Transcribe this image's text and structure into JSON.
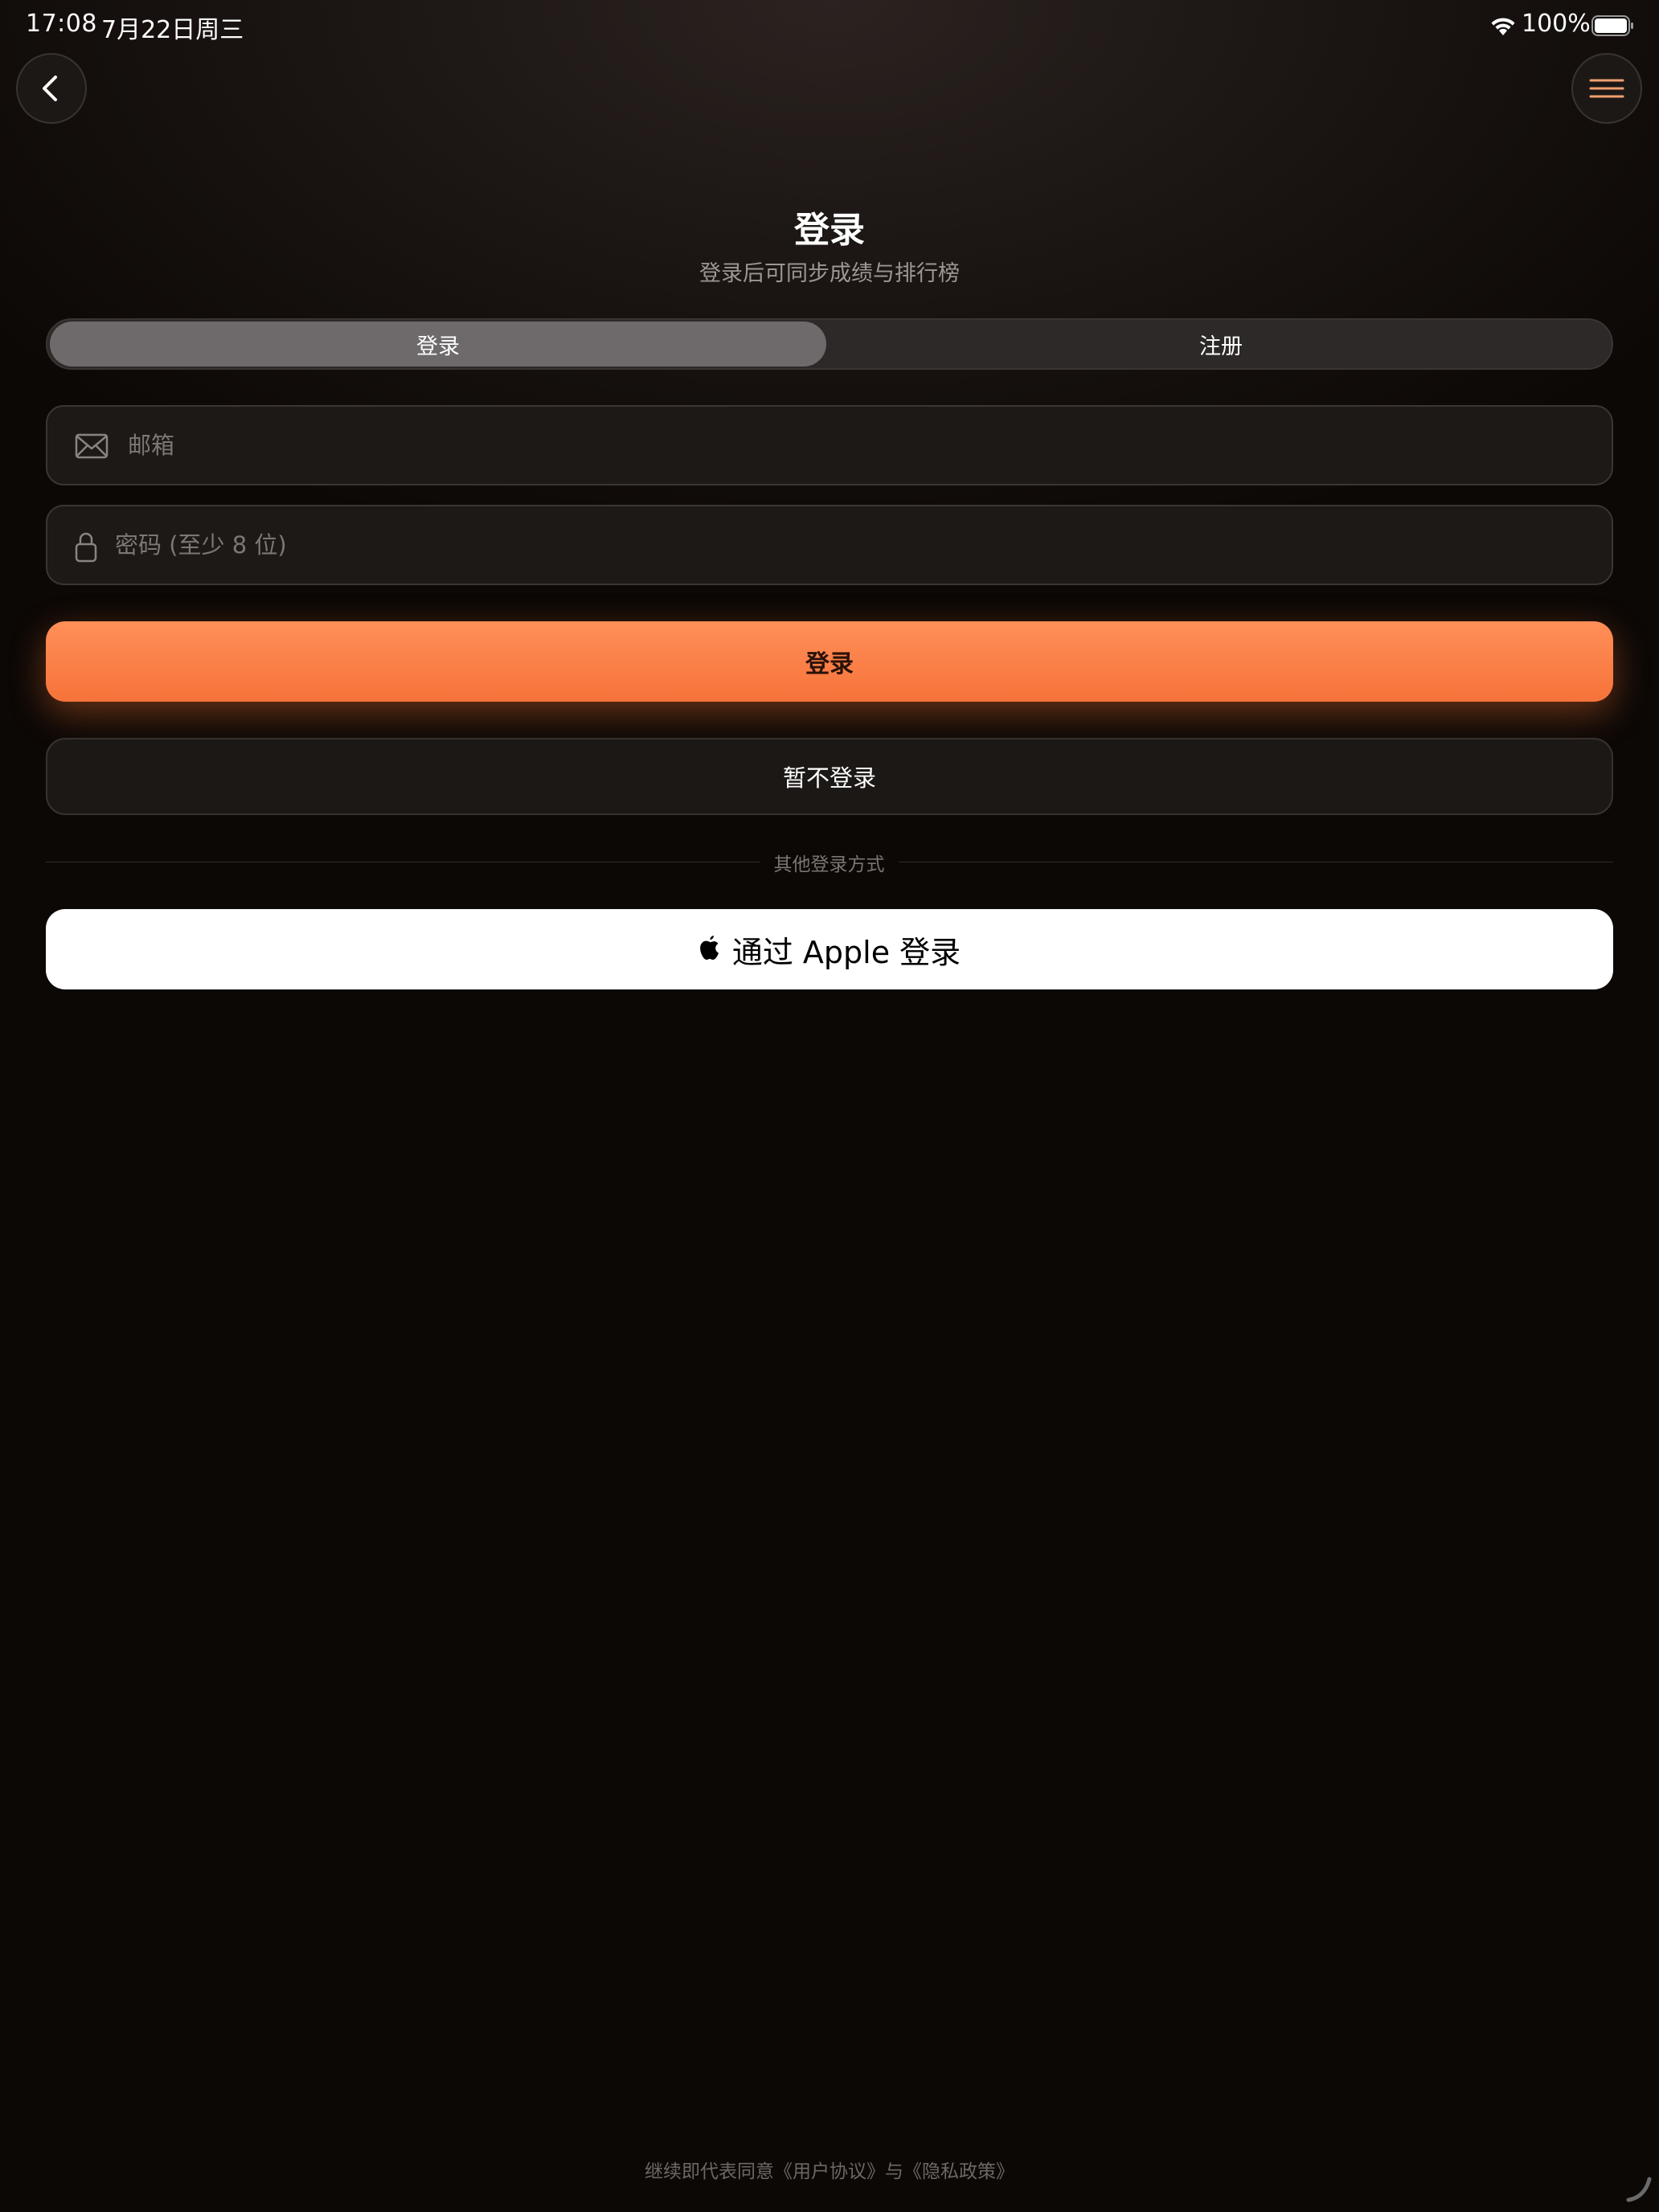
{
  "status_bar": {
    "time": "17:08",
    "date": "7月22日周三",
    "battery_percent": "100%",
    "wifi_icon": "wifi-icon",
    "battery_icon": "battery-icon"
  },
  "nav": {
    "back_icon": "chevron-left-icon",
    "menu_icon": "hamburger-menu-icon",
    "menu_icon_color": "#f0a070"
  },
  "header": {
    "title": "登录",
    "subtitle": "登录后可同步成绩与排行榜"
  },
  "tabs": [
    {
      "label": "登录",
      "active": true
    },
    {
      "label": "注册",
      "active": false
    }
  ],
  "form": {
    "email": {
      "value": "",
      "placeholder": "邮箱",
      "icon": "envelope-icon"
    },
    "password": {
      "value": "",
      "placeholder": "密码 (至少 8 位)",
      "icon": "lock-icon"
    }
  },
  "actions": {
    "login_label": "登录",
    "skip_label": "暂不登录",
    "accent_color": "#f77a40"
  },
  "divider": {
    "label": "其他登录方式"
  },
  "apple_signin": {
    "label": "通过 Apple 登录",
    "icon": "apple-logo-icon"
  },
  "footer": {
    "text": "继续即代表同意《用户协议》与《隐私政策》"
  }
}
